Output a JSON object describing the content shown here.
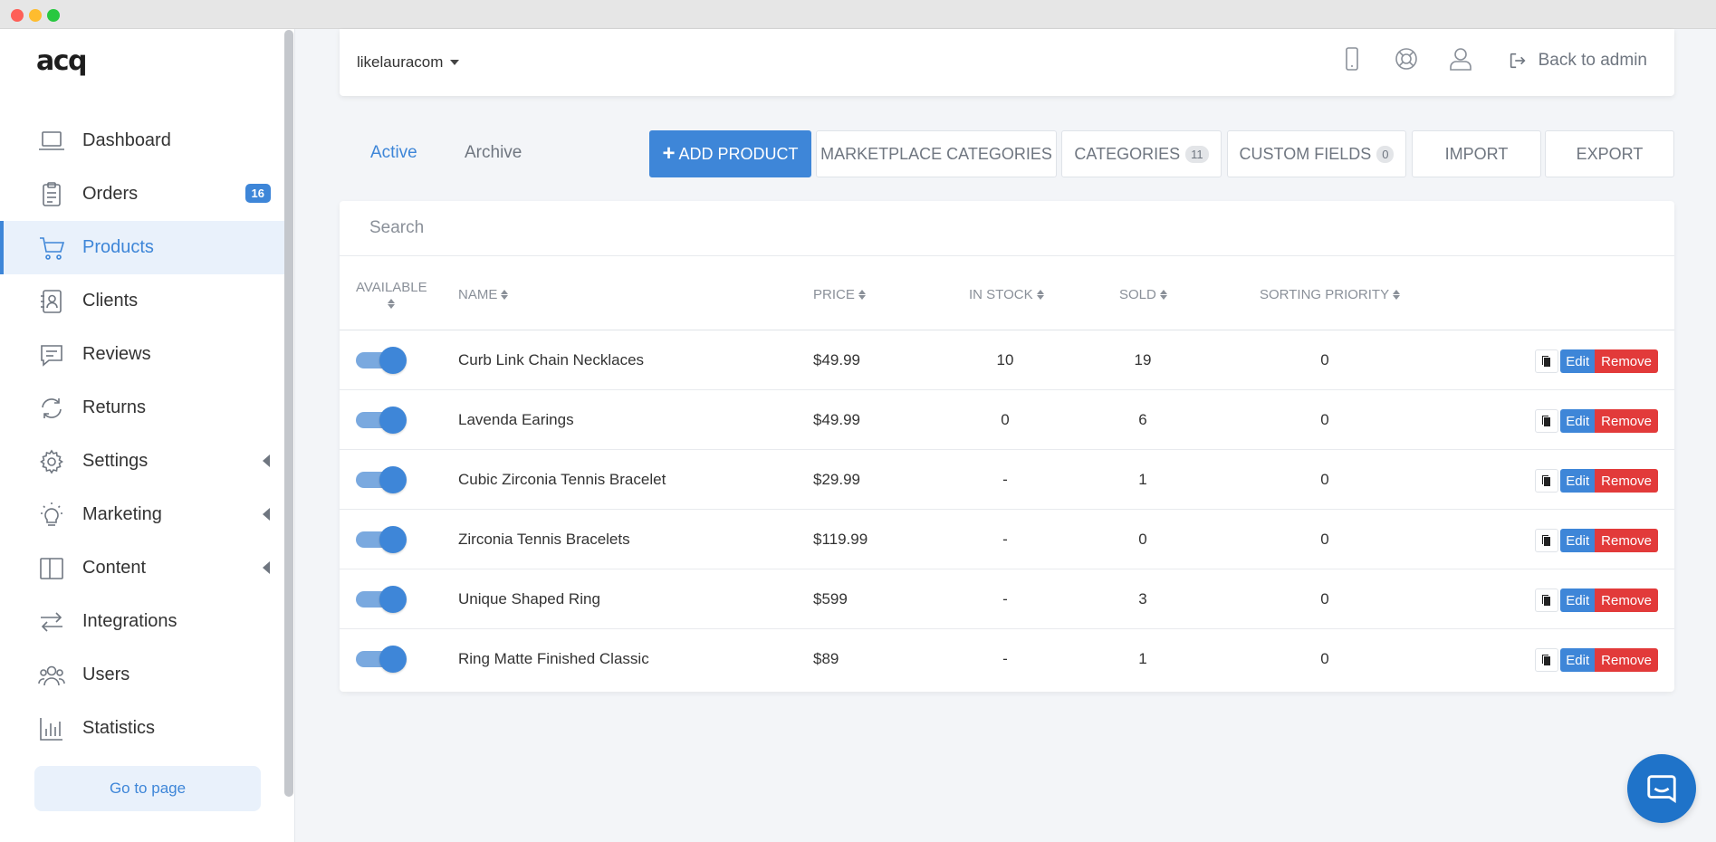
{
  "app": {
    "logo": "acq"
  },
  "colors": {
    "accent": "#3e86d8",
    "danger": "#e23a3a",
    "sidebar_active_bg": "#e9f1fb"
  },
  "sidebar": {
    "items": [
      {
        "label": "Dashboard",
        "icon": "laptop-icon",
        "active": false
      },
      {
        "label": "Orders",
        "icon": "clipboard-icon",
        "active": false,
        "badge": "16"
      },
      {
        "label": "Products",
        "icon": "cart-icon",
        "active": true
      },
      {
        "label": "Clients",
        "icon": "contact-book-icon",
        "active": false
      },
      {
        "label": "Reviews",
        "icon": "comment-icon",
        "active": false
      },
      {
        "label": "Returns",
        "icon": "refresh-icon",
        "active": false
      },
      {
        "label": "Settings",
        "icon": "gear-icon",
        "active": false,
        "expandable": true
      },
      {
        "label": "Marketing",
        "icon": "lightbulb-icon",
        "active": false,
        "expandable": true
      },
      {
        "label": "Content",
        "icon": "columns-icon",
        "active": false,
        "expandable": true
      },
      {
        "label": "Integrations",
        "icon": "transfer-icon",
        "active": false
      },
      {
        "label": "Users",
        "icon": "users-icon",
        "active": false
      },
      {
        "label": "Statistics",
        "icon": "bar-chart-icon",
        "active": false
      }
    ],
    "go_to_page": "Go to page"
  },
  "topbar": {
    "store": "likelauracom",
    "icons": [
      "mobile-icon",
      "lifebuoy-icon",
      "user-icon"
    ],
    "back_to_admin": "Back to admin"
  },
  "tabs": {
    "active": "Active",
    "archive": "Archive"
  },
  "actions": {
    "add_product": "ADD PRODUCT",
    "marketplace_categories": "MARKETPLACE CATEGORIES",
    "categories": "CATEGORIES",
    "categories_count": "11",
    "custom_fields": "CUSTOM FIELDS",
    "custom_fields_count": "0",
    "import": "IMPORT",
    "export": "EXPORT"
  },
  "table": {
    "search_placeholder": "Search",
    "columns": {
      "available": "AVAILABLE",
      "name": "NAME",
      "price": "PRICE",
      "in_stock": "IN STOCK",
      "sold": "SOLD",
      "sorting_priority": "SORTING PRIORITY"
    },
    "edit_label": "Edit",
    "remove_label": "Remove",
    "rows": [
      {
        "available": true,
        "name": "Curb Link Chain Necklaces",
        "price": "$49.99",
        "in_stock": "10",
        "sold": "19",
        "priority": "0"
      },
      {
        "available": true,
        "name": "Lavenda Earings",
        "price": "$49.99",
        "in_stock": "0",
        "sold": "6",
        "priority": "0"
      },
      {
        "available": true,
        "name": "Cubic Zirconia Tennis Bracelet",
        "price": "$29.99",
        "in_stock": "-",
        "sold": "1",
        "priority": "0"
      },
      {
        "available": true,
        "name": "Zirconia Tennis Bracelets",
        "price": "$119.99",
        "in_stock": "-",
        "sold": "0",
        "priority": "0"
      },
      {
        "available": true,
        "name": "Unique Shaped Ring",
        "price": "$599",
        "in_stock": "-",
        "sold": "3",
        "priority": "0"
      },
      {
        "available": true,
        "name": "Ring Matte Finished Classic",
        "price": "$89",
        "in_stock": "-",
        "sold": "1",
        "priority": "0"
      }
    ]
  }
}
